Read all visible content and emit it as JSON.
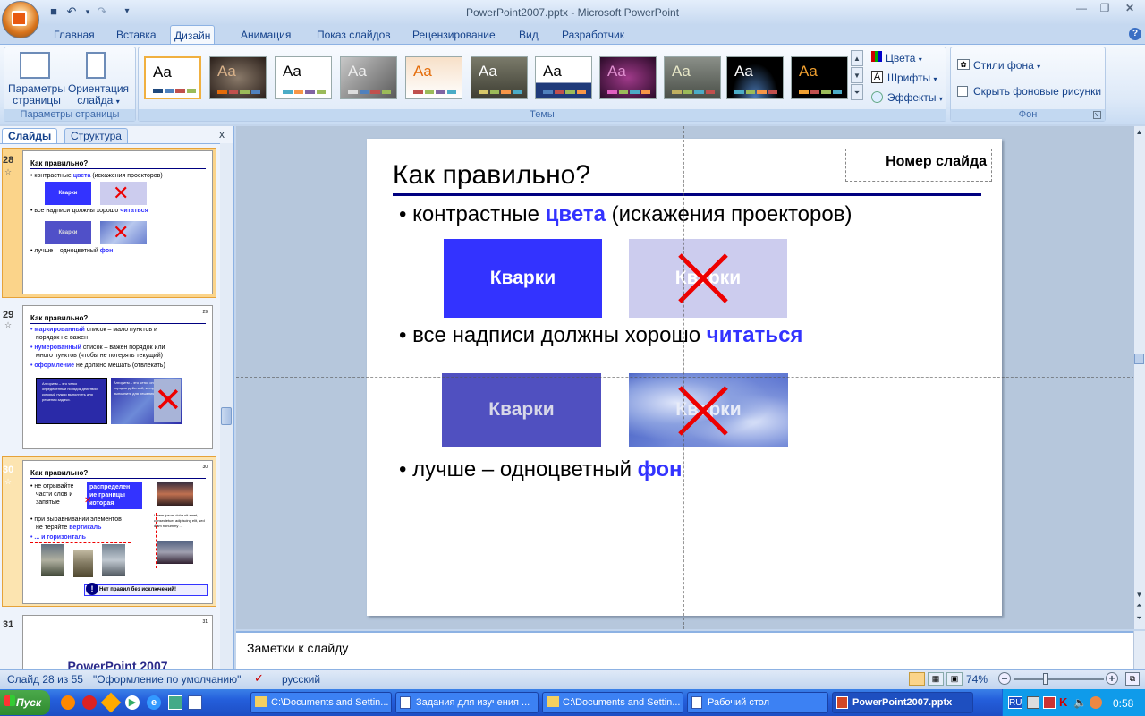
{
  "window": {
    "title": "PowerPoint2007.pptx - Microsoft PowerPoint"
  },
  "tabs": [
    "Главная",
    "Вставка",
    "Дизайн",
    "Анимация",
    "Показ слайдов",
    "Рецензирование",
    "Вид",
    "Разработчик"
  ],
  "ribbon": {
    "page_setup": {
      "params_label_1": "Параметры",
      "params_label_2": "страницы",
      "orient_label_1": "Ориентация",
      "orient_label_2": "слайда",
      "group_label": "Параметры страницы"
    },
    "themes": {
      "group_label": "Темы",
      "aa": "Aa"
    },
    "theme_options": {
      "colors": "Цвета",
      "fonts": "Шрифты",
      "effects": "Эффекты"
    },
    "background": {
      "styles": "Стили фона",
      "hide": "Скрыть фоновые рисунки",
      "group_label": "Фон"
    }
  },
  "panel": {
    "tab_slides": "Слайды",
    "tab_outline": "Структура",
    "close": "x"
  },
  "thumbs": {
    "s28": {
      "num": "28",
      "title": "Как правильно?",
      "b1a": "• контрастные ",
      "b1b": "цвета",
      "b1c": " (искажения проекторов)",
      "kv": "Кварки",
      "b2a": "• все надписи должны хорошо ",
      "b2b": "читаться",
      "b3a": "• лучше – одноцветный ",
      "b3b": "фон"
    },
    "s29": {
      "num": "29",
      "corner": "29",
      "title": "Как правильно?",
      "l1a": "• маркированный",
      "l1b": " список – мало пунктов и",
      "l2": "порядок не важен",
      "l3a": "• нумерованный",
      "l3b": " список – важен порядок или",
      "l4": "много пунктов (чтобы не потерять текущий)",
      "l5a": "• оформление",
      "l5b": " не должно мешать (отвлекать)",
      "box": "Алгоритм – это четко определенный порядок действий, который нужно выполнить для решения задачи."
    },
    "s30": {
      "num": "30",
      "corner": "30",
      "title": "Как правильно?",
      "l1": "• не отрывайте",
      "l2": "части слов и",
      "l3": "запятые",
      "blue1": "распределен",
      "blue2": "ие границы",
      "blue3": "которая",
      "l4": "• при выравнивании элементов",
      "l5a": "не теряйте ",
      "l5b": "вертикаль",
      "l6": "• ... и горизонталь",
      "lorem": "Lorem ipsum dolor sit amet, consectetuer adipiscing elit, sed diam nonummy ...",
      "note": "Нет правил без исключений!"
    },
    "s31": {
      "num": "31",
      "corner": "31",
      "title": "PowerPoint 2007"
    }
  },
  "slide": {
    "title": "Как правильно?",
    "number_box": "Номер слайда",
    "bullet1_a": "контрастные ",
    "bullet1_b": "цвета",
    "bullet1_c": " (искажения проекторов)",
    "bullet2_a": "все надписи должны хорошо ",
    "bullet2_b": "читаться",
    "bullet3_a": "лучше – одноцветный ",
    "bullet3_b": "фон",
    "box_label": "Кварки",
    "bullet_char": "•"
  },
  "notes": {
    "placeholder": "Заметки к слайду"
  },
  "status": {
    "slide": "Слайд 28 из 55",
    "theme": "\"Оформление по умолчанию\"",
    "lang": "русский",
    "zoom": "74%"
  },
  "taskbar": {
    "start": "Пуск",
    "tasks": [
      "C:\\Documents and Settin...",
      "Задания для изучения ...",
      "C:\\Documents and Settin...",
      "Рабочий стол",
      "PowerPoint2007.pptx"
    ],
    "lang": "RU",
    "clock": "0:58"
  },
  "colors": {
    "accent": "#3333ff",
    "title_rule": "#000080",
    "selected_thumb": "#fbd48a",
    "taskbar": "#245edb"
  }
}
